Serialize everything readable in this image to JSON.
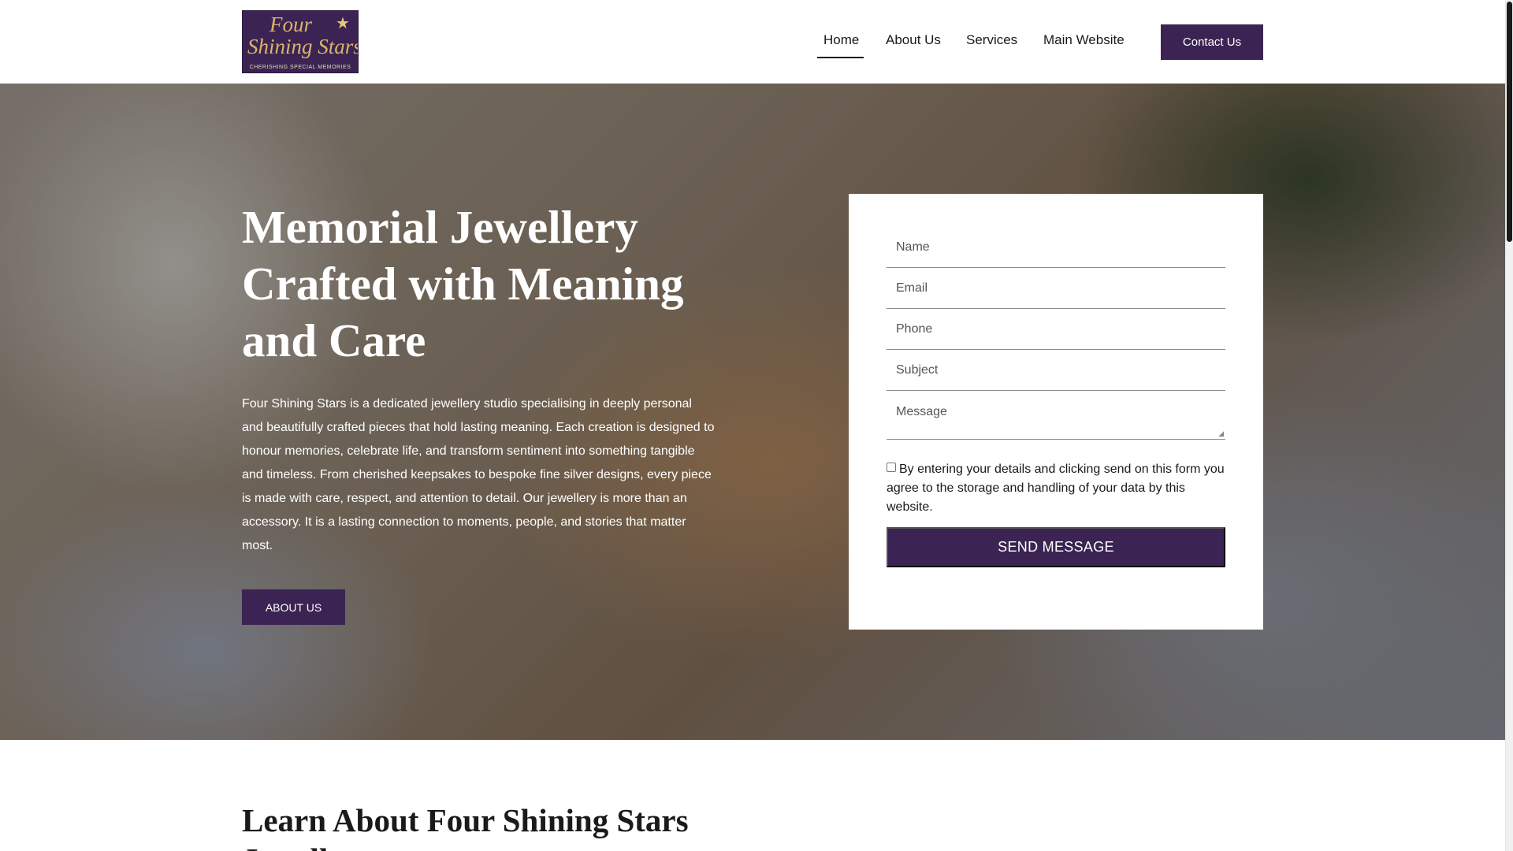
{
  "header": {
    "logo": {
      "line1": "Four",
      "line2": "Shining Stars",
      "tagline": "CHERISHING SPECIAL MEMORIES",
      "icon": "star-icon",
      "background_color": "#3b2453",
      "text_color": "#d9b56a"
    },
    "nav": {
      "items": [
        {
          "label": "Home",
          "active": true
        },
        {
          "label": "About Us",
          "active": false
        },
        {
          "label": "Services",
          "active": false
        },
        {
          "label": "Main Website",
          "active": false
        }
      ]
    },
    "cta_label": "Contact Us"
  },
  "hero": {
    "title": "Memorial Jewellery Crafted with Meaning and Care",
    "text": "Four Shining Stars is a dedicated jewellery studio specialising in deeply personal and beautifully crafted pieces that hold lasting meaning. Each creation is designed to honour memories, celebrate life, and transform sentiment into something tangible and timeless. From cherished keepsakes to bespoke fine silver designs, every piece is made with care, respect, and attention to detail. Our jewellery is more than an accessory. It is a lasting connection to moments, people, and stories that matter most.",
    "button_label": "ABOUT US"
  },
  "form": {
    "fields": {
      "name": "Name",
      "email": "Email",
      "phone": "Phone",
      "subject": "Subject",
      "message": "Message"
    },
    "consent_text": "By entering your details and clicking send on this form you agree to the storage and handling of your data by this website.",
    "consent_checked": false,
    "submit_label": "SEND MESSAGE"
  },
  "section": {
    "title_line1": "Learn About Four Shining Stars",
    "title_line2": "Jewellery"
  },
  "colors": {
    "accent": "#3b2453",
    "text": "#1a1a1a",
    "white": "#ffffff"
  }
}
